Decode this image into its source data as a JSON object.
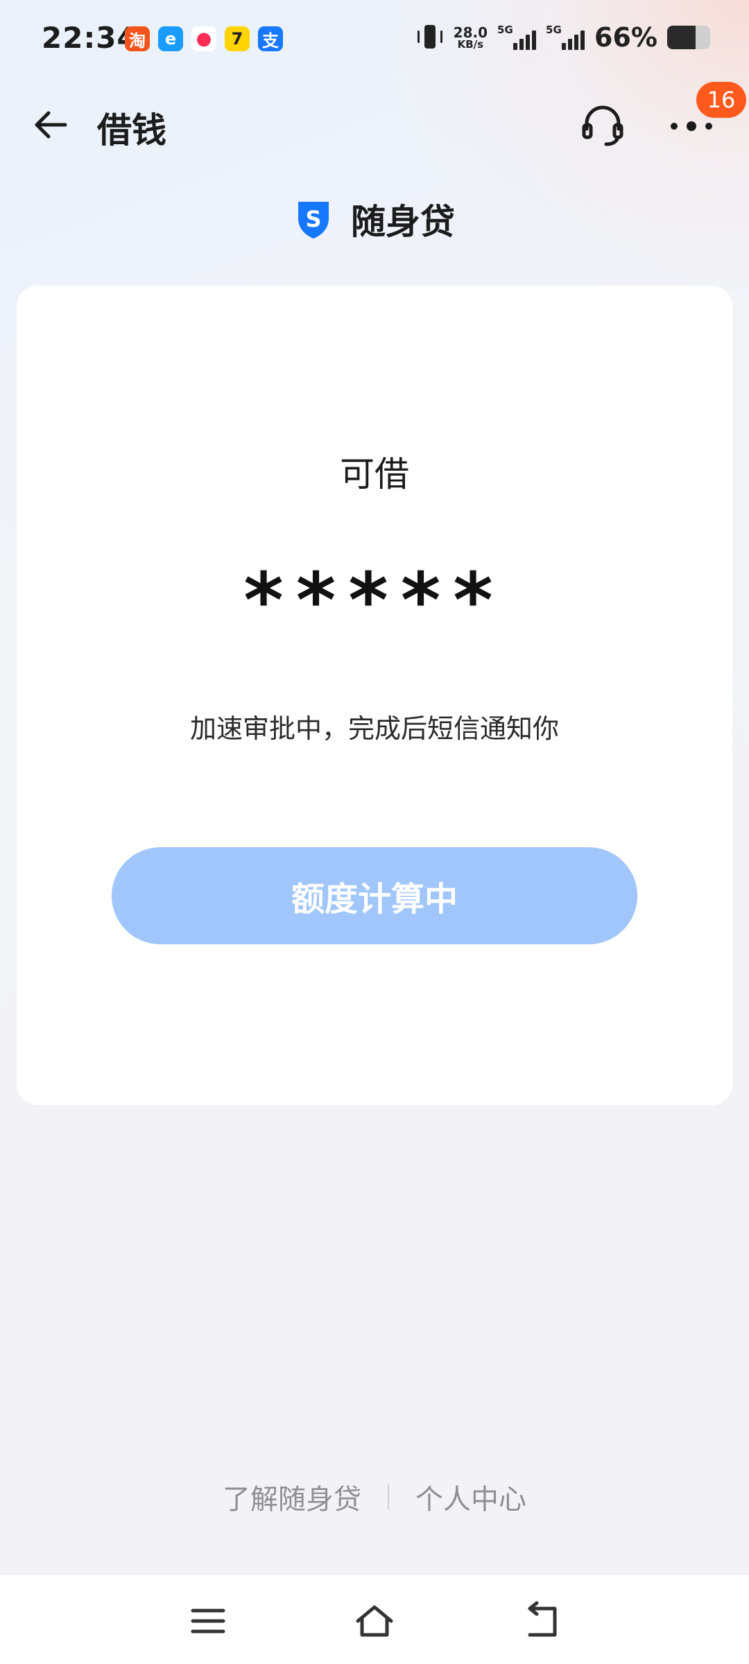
{
  "status_bar": {
    "time": "22:34",
    "apps": [
      {
        "name": "taobao-icon",
        "glyph": "淘",
        "color": "#f2541b"
      },
      {
        "name": "eleme-icon",
        "glyph": "e",
        "color": "#1a9bff"
      },
      {
        "name": "video-icon",
        "glyph": "●",
        "color": "#ff2c55"
      },
      {
        "name": "qimao-icon",
        "glyph": "7",
        "color": "#ffd400"
      },
      {
        "name": "alipay-icon",
        "glyph": "支",
        "color": "#1677ff"
      }
    ],
    "net_speed": "28.0",
    "net_unit": "KB/s",
    "sim1": "5G",
    "sim2": "5G",
    "battery_pct": "66%",
    "battery_level": 0.66
  },
  "header": {
    "title": "借钱",
    "badge_count": "16"
  },
  "brand": {
    "name": "随身贷",
    "logo_letter": "S",
    "logo_color": "#1677ff"
  },
  "card": {
    "label": "可借",
    "amount": "*****",
    "note": "加速审批中，完成后短信通知你",
    "button_label": "额度计算中",
    "button_color": "#a0c6fb"
  },
  "footer": {
    "link_about": "了解随身贷",
    "link_personal": "个人中心"
  },
  "nav": {
    "icons": [
      "menu-icon",
      "home-icon",
      "back-icon"
    ]
  }
}
